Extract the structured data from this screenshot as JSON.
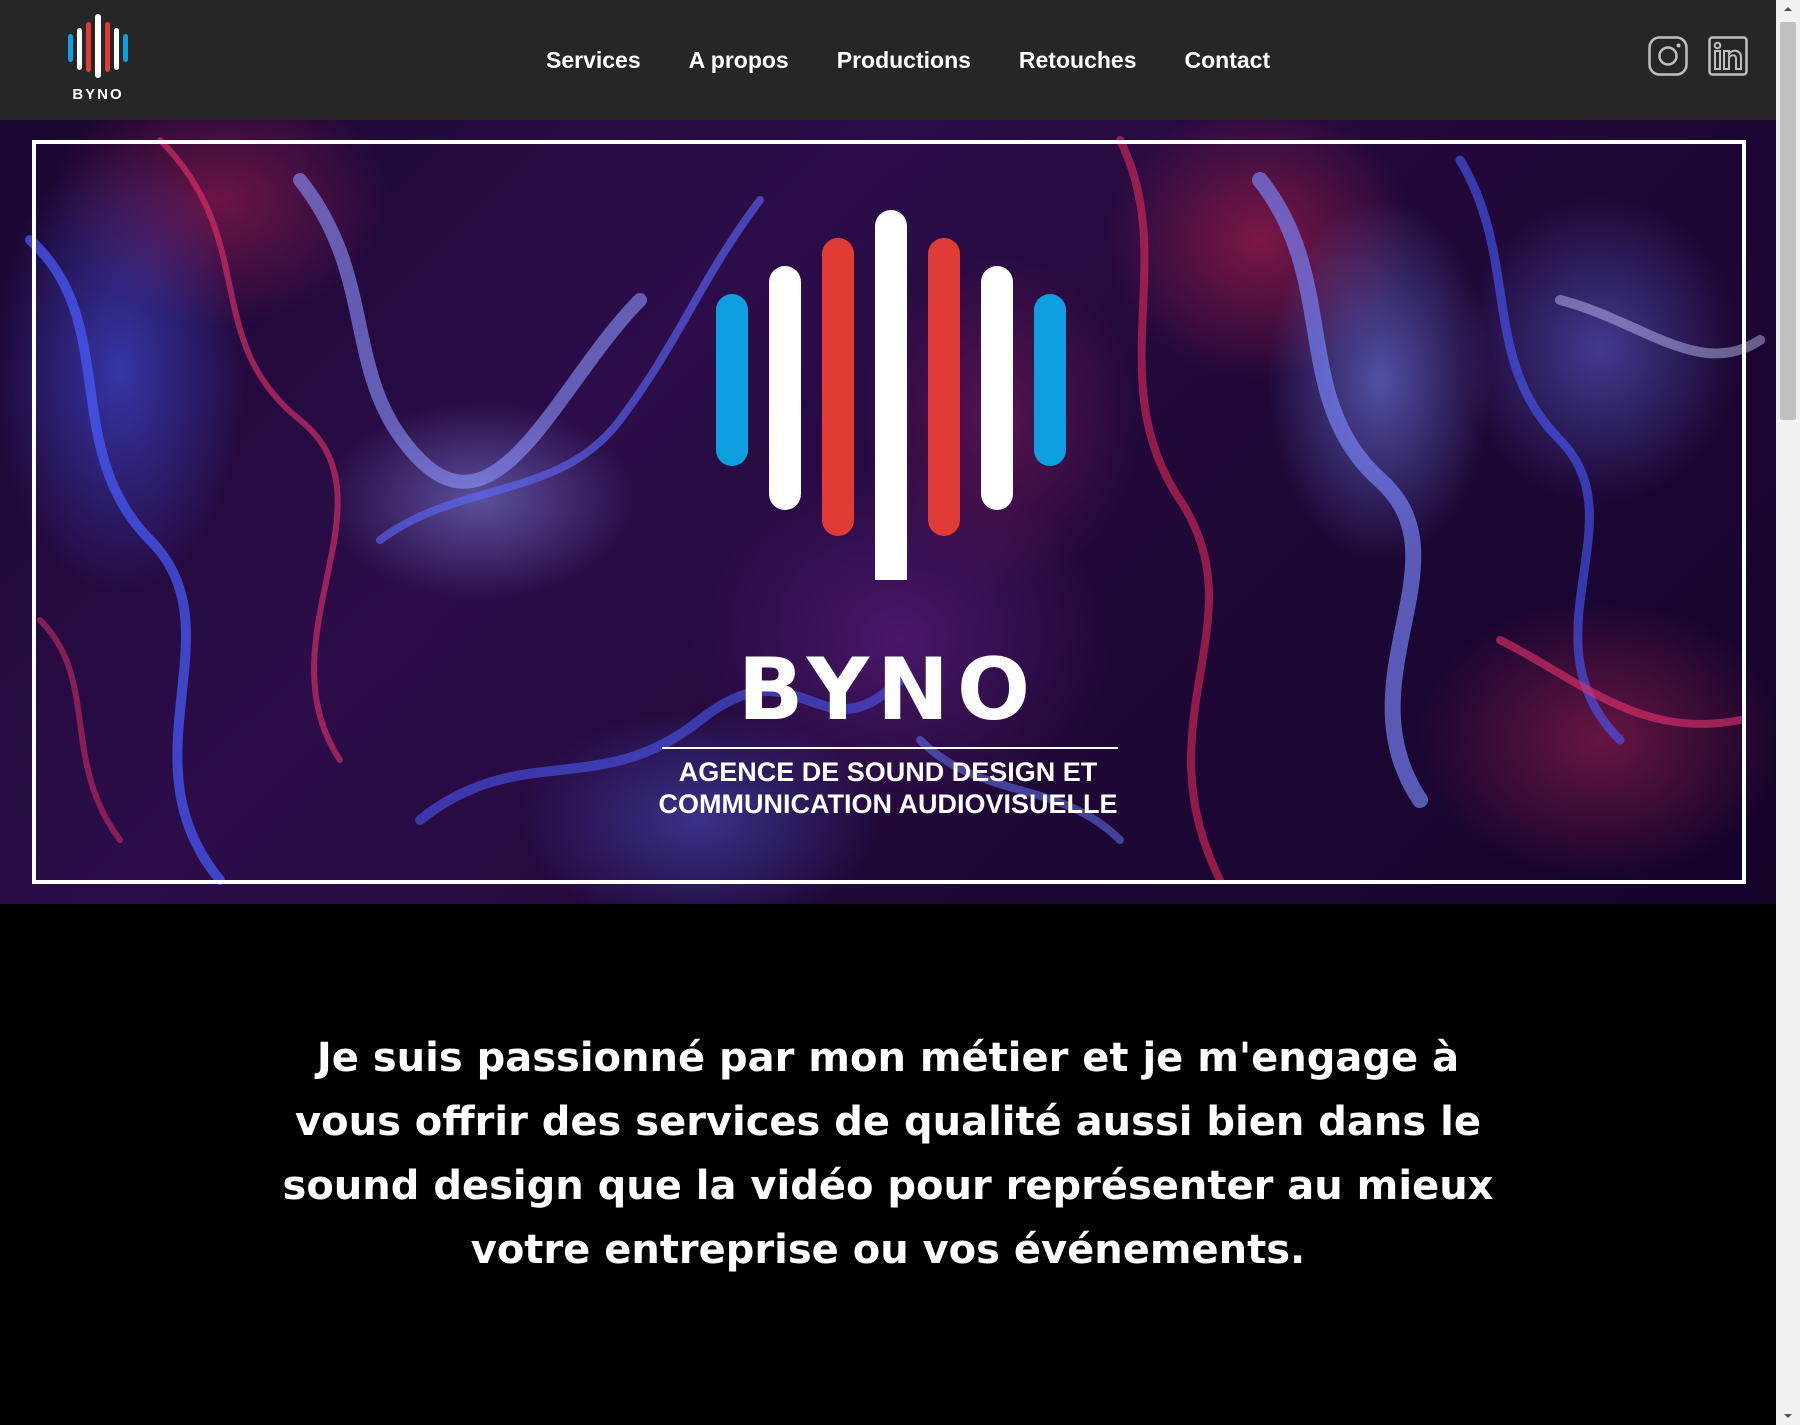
{
  "header": {
    "logo_text": "BYNO",
    "nav": [
      {
        "label": "Services"
      },
      {
        "label": "A propos"
      },
      {
        "label": "Productions"
      },
      {
        "label": "Retouches"
      },
      {
        "label": "Contact"
      }
    ],
    "social": [
      {
        "icon": "instagram-icon"
      },
      {
        "icon": "linkedin-icon"
      }
    ]
  },
  "hero": {
    "title": "BYNO",
    "subtitle_line1": "AGENCE DE SOUND DESIGN ET",
    "subtitle_line2": "COMMUNICATION AUDIOVISUELLE"
  },
  "intro": {
    "text": "Je suis passionné par mon métier et je m'engage à vous offrir des services de qualité aussi bien dans le sound design que la vidéo pour représenter au mieux votre entreprise ou vos événements."
  },
  "colors": {
    "header_bg": "#262626",
    "brand_blue": "#0d9fe0",
    "brand_red": "#e03c35",
    "brand_white": "#ffffff",
    "page_bg": "#000000"
  }
}
